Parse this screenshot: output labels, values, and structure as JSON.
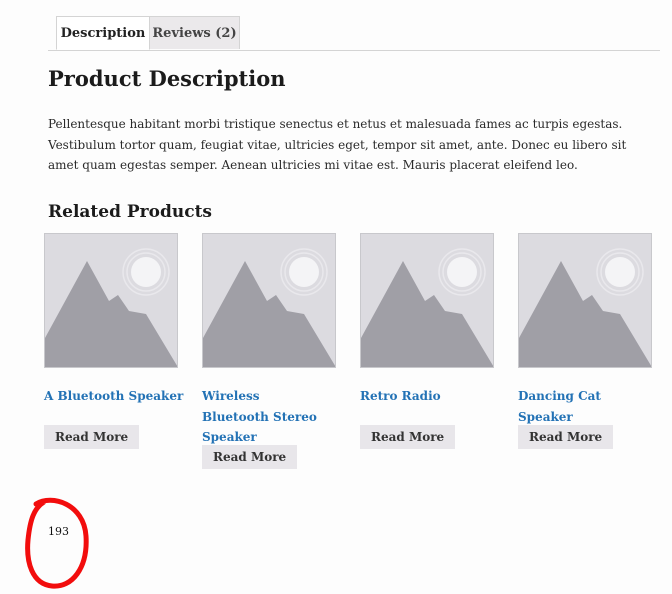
{
  "tabs": [
    {
      "label": "Description",
      "active": true
    },
    {
      "label": "Reviews (2)",
      "active": false
    }
  ],
  "main": {
    "heading": "Product Description",
    "description": "Pellentesque habitant morbi tristique senectus et netus et malesuada fames ac turpis egestas. Vestibulum tortor quam, feugiat vitae, ultricies eget, tempor sit amet, ante. Donec eu libero sit amet quam egestas semper. Aenean ultricies mi vitae est. Mauris placerat eleifend leo."
  },
  "related": {
    "heading": "Related Products",
    "products": [
      {
        "title": "A Bluetooth Speaker",
        "button": "Read More",
        "image_icon": "placeholder-image-icon"
      },
      {
        "title": "Wireless Bluetooth Stereo Speaker",
        "button": "Read More",
        "image_icon": "placeholder-image-icon"
      },
      {
        "title": "Retro Radio",
        "button": "Read More",
        "image_icon": "placeholder-image-icon"
      },
      {
        "title": "Dancing Cat Speaker",
        "button": "Read More",
        "image_icon": "placeholder-image-icon"
      }
    ]
  },
  "footer": {
    "page_number": "193"
  },
  "colors": {
    "link": "#2372b5",
    "annotation": "#f20d0d",
    "tab_inactive_bg": "#ebe9eb",
    "button_bg": "#e8e6ea",
    "placeholder_bg": "#dcdbe0",
    "placeholder_shape": "#a09fa6"
  }
}
